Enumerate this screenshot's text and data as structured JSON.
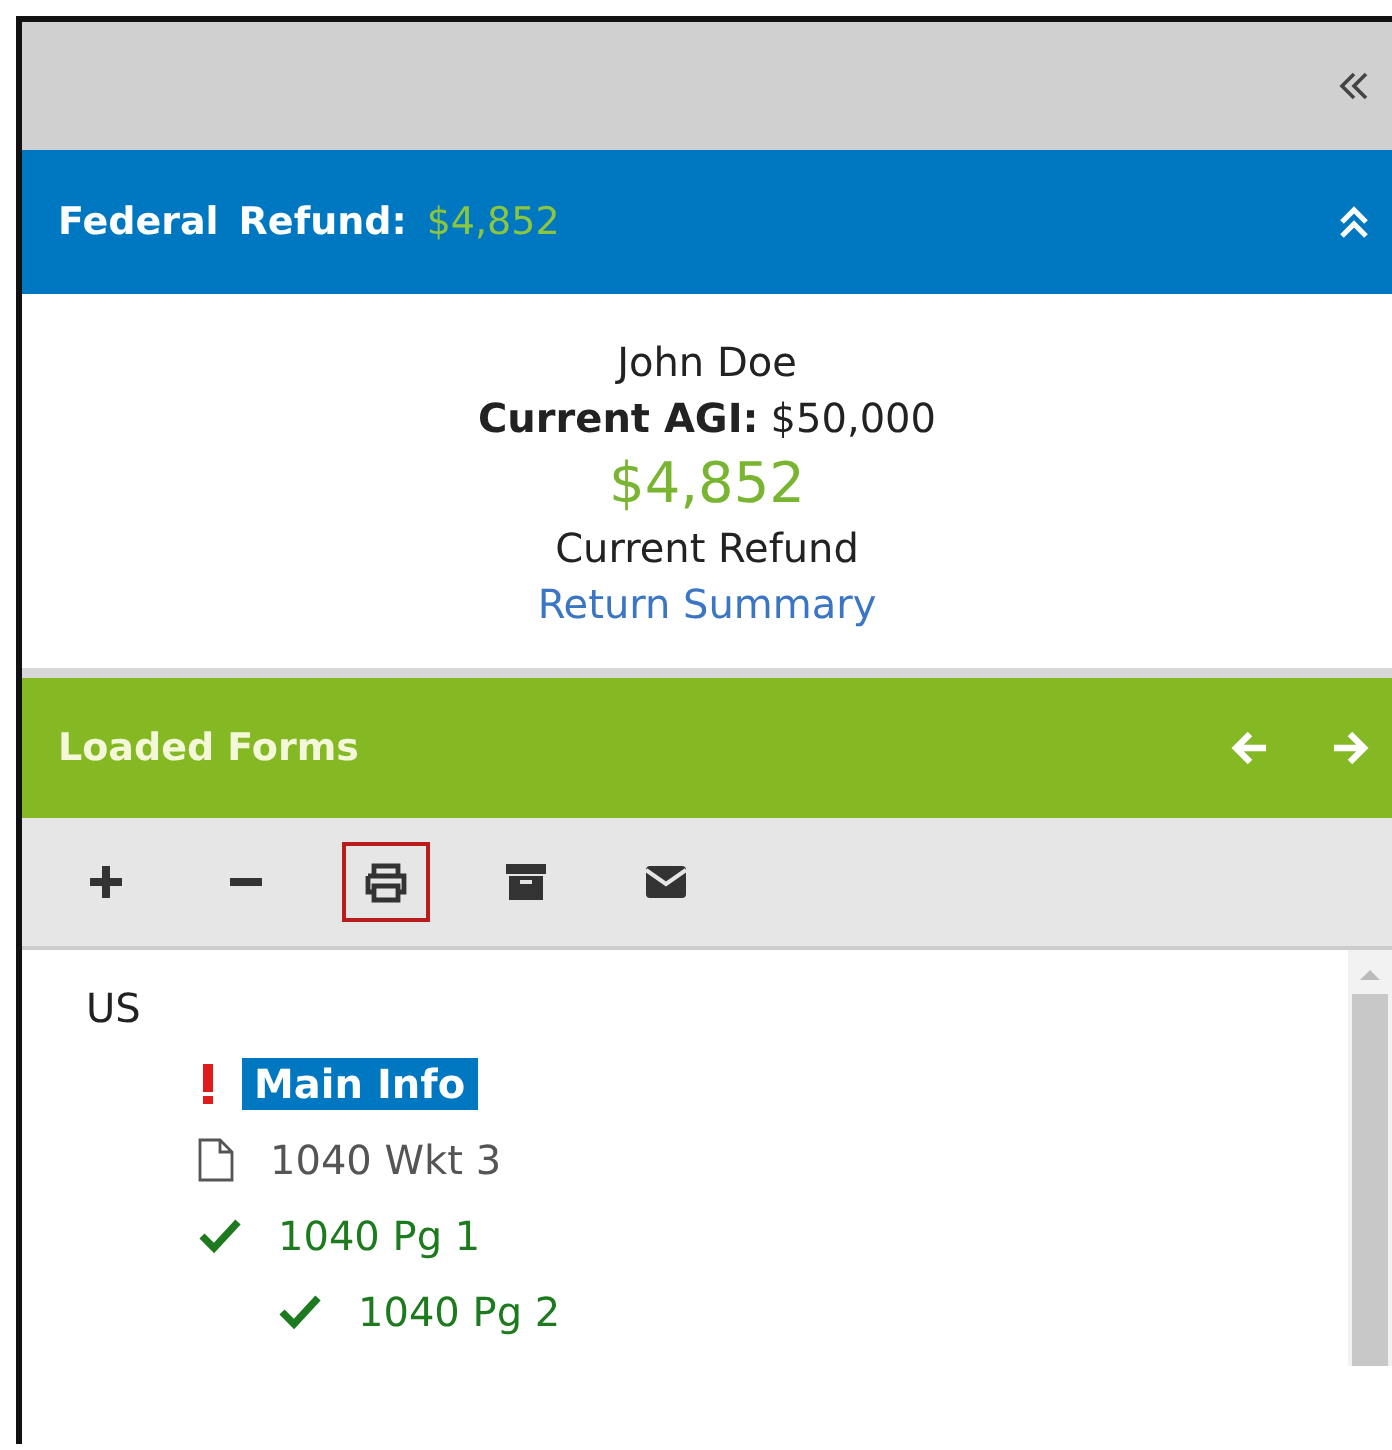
{
  "federal": {
    "label": "Federal",
    "refund_label": "Refund:",
    "refund_amount": "$4,852",
    "expanded": true
  },
  "summary": {
    "name": "John Doe",
    "agi_label": "Current AGI:",
    "agi_value": "$50,000",
    "refund": "$4,852",
    "refund_caption": "Current Refund",
    "link": "Return Summary"
  },
  "loaded_forms": {
    "title": "Loaded Forms"
  },
  "toolbar": [
    {
      "kind": "add",
      "selected": false
    },
    {
      "kind": "remove",
      "selected": false
    },
    {
      "kind": "print",
      "selected": true
    },
    {
      "kind": "archive",
      "selected": false
    },
    {
      "kind": "email",
      "selected": false
    }
  ],
  "tree": [
    {
      "label": "US",
      "kind": "folder",
      "selected": false,
      "children": [
        {
          "label": "Main Info",
          "kind": "error",
          "selected": true
        },
        {
          "label": "1040 Wkt 3",
          "kind": "blank",
          "selected": false
        },
        {
          "label": "1040 Pg 1",
          "kind": "complete",
          "selected": false,
          "children": [
            {
              "label": "1040 Pg 2",
              "kind": "complete",
              "selected": false
            }
          ]
        }
      ]
    }
  ]
}
